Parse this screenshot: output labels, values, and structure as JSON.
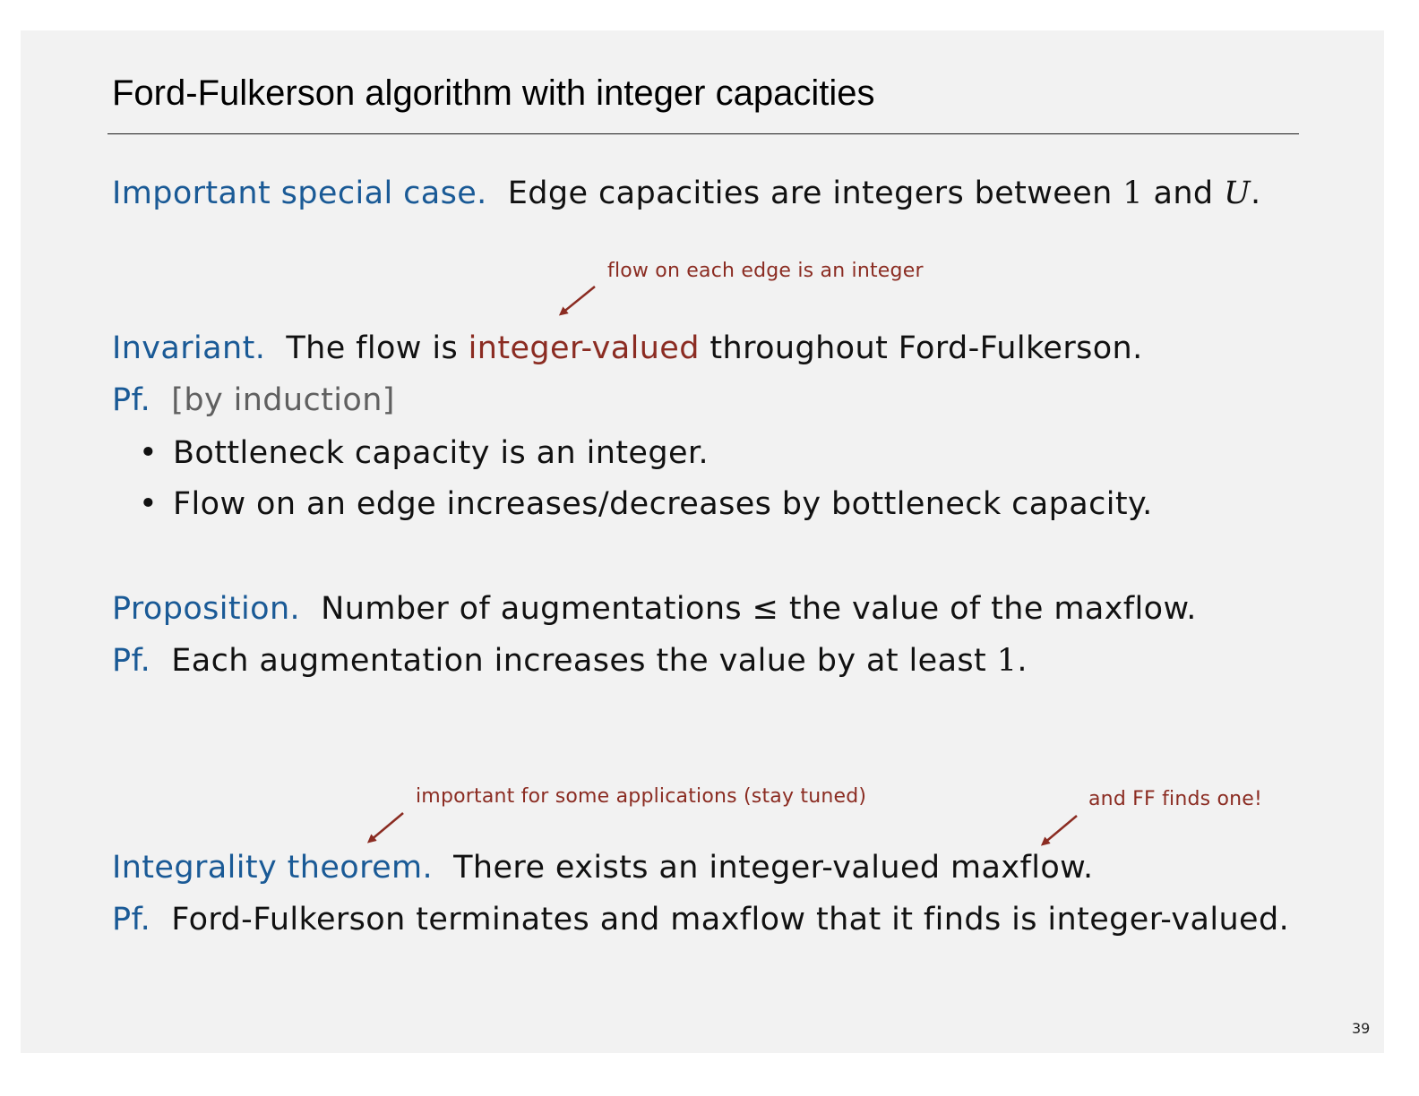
{
  "title": "Ford-Fulkerson algorithm with integer capacities",
  "special_case": {
    "label": "Important special case.",
    "text_before": "Edge capacities are integers between",
    "num": "1",
    "and": "and",
    "var": "U",
    "period": "."
  },
  "note_flow": "flow on each edge is an integer",
  "invariant": {
    "label": "Invariant.",
    "text_before": "The flow is",
    "highlight": "integer-valued",
    "text_after": "throughout Ford-Fulkerson."
  },
  "proof1": {
    "label": "Pf.",
    "text": "[by induction]",
    "bullets": [
      "Bottleneck capacity is an integer.",
      "Flow on an edge increases/decreases by bottleneck capacity."
    ]
  },
  "proposition": {
    "label": "Proposition.",
    "text": "Number of augmentations ≤ the value of the maxflow."
  },
  "proof2": {
    "label": "Pf.",
    "text_before": "Each augmentation increases the value by at least",
    "num": "1",
    "period": "."
  },
  "note_important": "important for some applications (stay tuned)",
  "note_ff": "and FF finds one!",
  "integrality": {
    "label": "Integrality theorem.",
    "text": "There exists an integer-valued maxflow."
  },
  "proof3": {
    "label": "Pf.",
    "text": "Ford-Fulkerson terminates and maxflow that it finds is integer-valued."
  },
  "page_number": "39",
  "colors": {
    "label_blue": "#1a5a96",
    "annotation_red": "#8b2c22",
    "background": "#f2f2f2"
  }
}
